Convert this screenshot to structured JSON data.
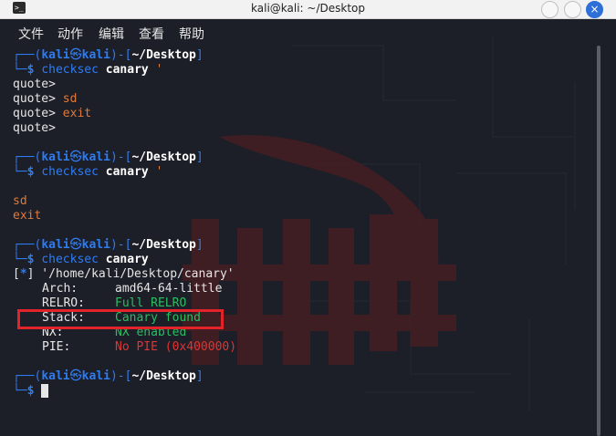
{
  "window": {
    "title": "kali@kali: ~/Desktop",
    "close_glyph": "×"
  },
  "menu": [
    "文件",
    "动作",
    "编辑",
    "查看",
    "帮助"
  ],
  "prompt": {
    "top": "┌──(",
    "user": "kali",
    "at": "㉿",
    "host": "kali",
    "sep": ")-[",
    "path": "~/Desktop",
    "end": "]",
    "bottom": "└─",
    "dollar": "$"
  },
  "session": {
    "cmd1": "checksec",
    "cmd1_arg": "canary",
    "cmd1_quote": "'",
    "quote_lines": [
      "quote>",
      "quote> ",
      "quote> ",
      "quote>"
    ],
    "quote_texts": [
      "sd",
      "exit"
    ],
    "out2": [
      "sd",
      "exit"
    ],
    "checksec_header_prefix": "[",
    "checksec_header_star": "*",
    "checksec_header_suffix": "] '/home/kali/Desktop/canary'",
    "rows": [
      {
        "key": "Arch:",
        "value": "amd64-64-little",
        "color": "#e6e6e6"
      },
      {
        "key": "RELRO:",
        "value": "Full RELRO",
        "color": "#2bbd62"
      },
      {
        "key": "Stack:",
        "value": "Canary found",
        "color": "#2bbd62"
      },
      {
        "key": "NX:",
        "value": "NX enabled",
        "color": "#2bbd62"
      },
      {
        "key": "PIE:",
        "value": "No PIE (0x400000)",
        "color": "#e03434"
      }
    ]
  },
  "colors": {
    "prompt_blue": "#2f7bf0",
    "highlight_red": "#e3232a",
    "string_orange": "#e07a3a"
  }
}
